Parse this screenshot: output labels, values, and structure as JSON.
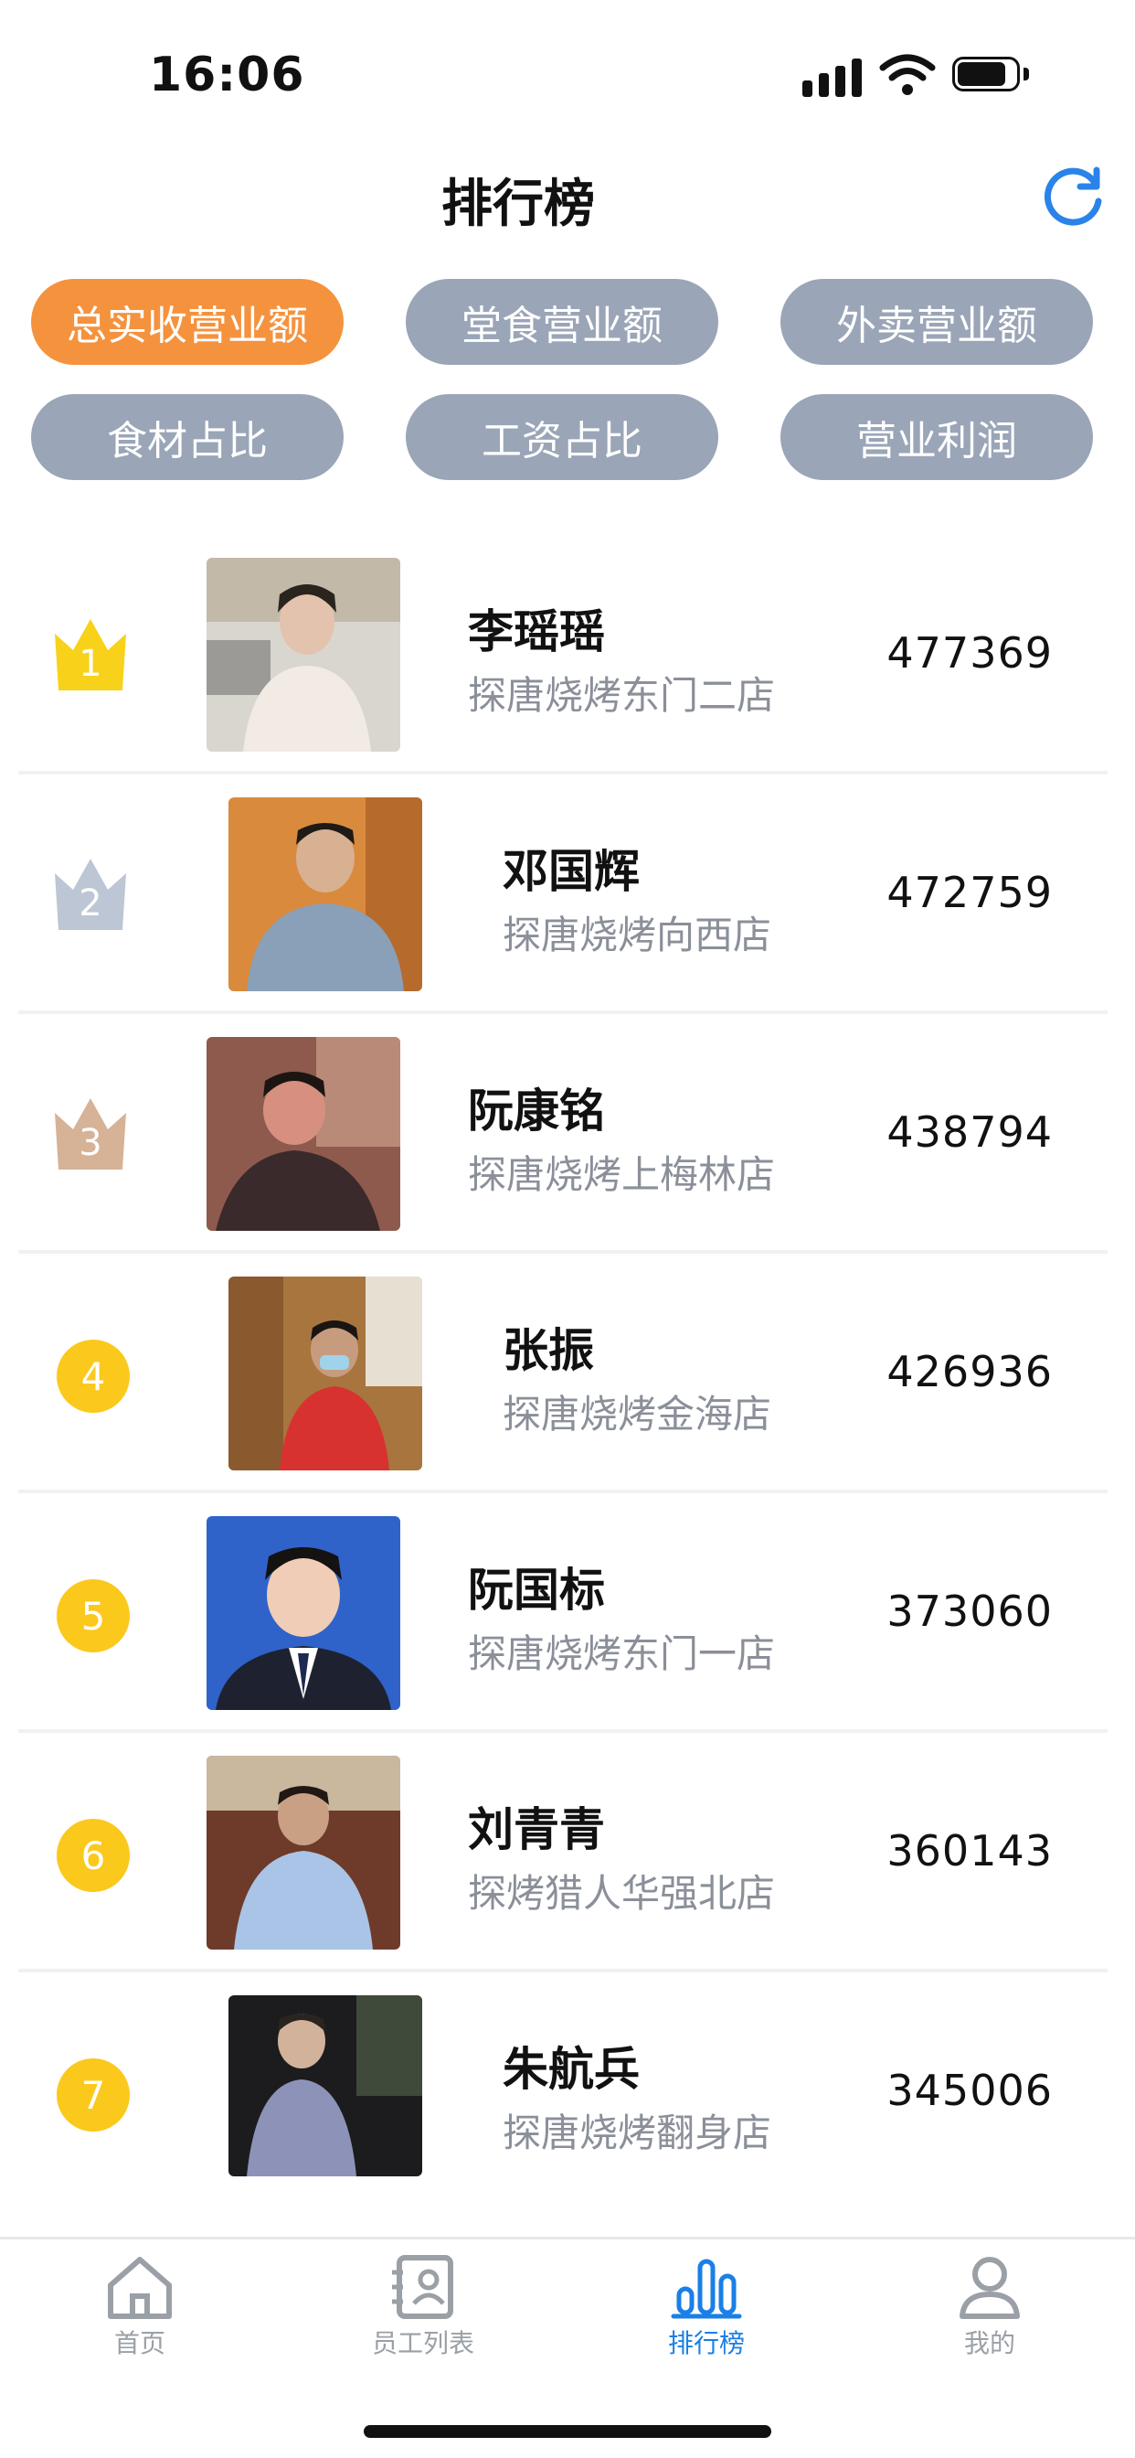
{
  "status_bar": {
    "time": "16:06"
  },
  "header": {
    "title": "排行榜",
    "refresh_icon": "refresh-icon"
  },
  "tabs": [
    {
      "label": "总实收营业额",
      "active": true
    },
    {
      "label": "堂食营业额",
      "active": false
    },
    {
      "label": "外卖营业额",
      "active": false
    },
    {
      "label": "食材占比",
      "active": false
    },
    {
      "label": "工资占比",
      "active": false
    },
    {
      "label": "营业利润",
      "active": false
    }
  ],
  "ranking": [
    {
      "rank": "1",
      "name": "李瑶瑶",
      "store": "探唐烧烤东门二店",
      "value": "477369"
    },
    {
      "rank": "2",
      "name": "邓国辉",
      "store": "探唐烧烤向西店",
      "value": "472759"
    },
    {
      "rank": "3",
      "name": "阮康铭",
      "store": "探唐烧烤上梅林店",
      "value": "438794"
    },
    {
      "rank": "4",
      "name": "张振",
      "store": "探唐烧烤金海店",
      "value": "426936"
    },
    {
      "rank": "5",
      "name": "阮国标",
      "store": "探唐烧烤东门一店",
      "value": "373060"
    },
    {
      "rank": "6",
      "name": "刘青青",
      "store": "探烤猎人华强北店",
      "value": "360143"
    },
    {
      "rank": "7",
      "name": "朱航兵",
      "store": "探唐烧烤翻身店",
      "value": "345006"
    }
  ],
  "nav": [
    {
      "label": "首页",
      "icon": "home-icon",
      "active": false
    },
    {
      "label": "员工列表",
      "icon": "contacts-icon",
      "active": false
    },
    {
      "label": "排行榜",
      "icon": "bar-chart-icon",
      "active": true
    },
    {
      "label": "我的",
      "icon": "user-icon",
      "active": false
    }
  ],
  "colors": {
    "accent": "#f5923e",
    "tab_inactive": "#9aa5b7",
    "nav_active": "#1a7fe6",
    "gold": "#fbc81c"
  }
}
